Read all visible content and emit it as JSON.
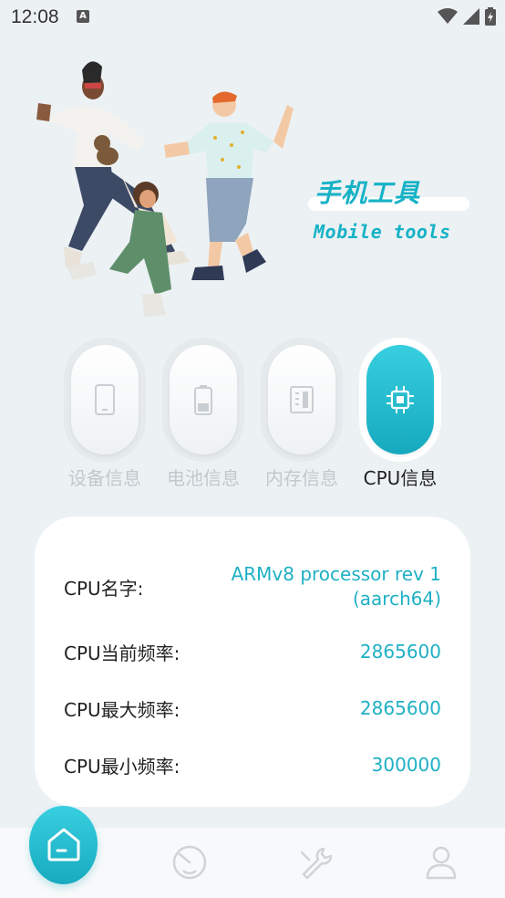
{
  "status_bar": {
    "time": "12:08",
    "notification_letter": "A"
  },
  "hero": {
    "title": "手机工具",
    "subtitle": "Mobile tools"
  },
  "tabs": [
    {
      "label": "设备信息",
      "icon": "phone-icon",
      "active": false
    },
    {
      "label": "电池信息",
      "icon": "battery-icon",
      "active": false
    },
    {
      "label": "内存信息",
      "icon": "memory-icon",
      "active": false
    },
    {
      "label": "CPU信息",
      "icon": "chip-icon",
      "active": true
    }
  ],
  "cpu_info": [
    {
      "label": "CPU名字:",
      "value_line1": "ARMv8 processor rev 1",
      "value_line2": "(aarch64)"
    },
    {
      "label": "CPU当前频率:",
      "value": "2865600"
    },
    {
      "label": "CPU最大频率:",
      "value": "2865600"
    },
    {
      "label": "CPU最小频率:",
      "value": "300000"
    }
  ],
  "bottom_nav": [
    {
      "icon": "home-icon",
      "active": true
    },
    {
      "icon": "speedometer-icon",
      "active": false
    },
    {
      "icon": "wrench-icon",
      "active": false
    },
    {
      "icon": "user-icon",
      "active": false
    }
  ],
  "colors": {
    "accent": "#1eb0c4",
    "background": "#ecf1f4",
    "inactive": "#c4c8cb"
  }
}
